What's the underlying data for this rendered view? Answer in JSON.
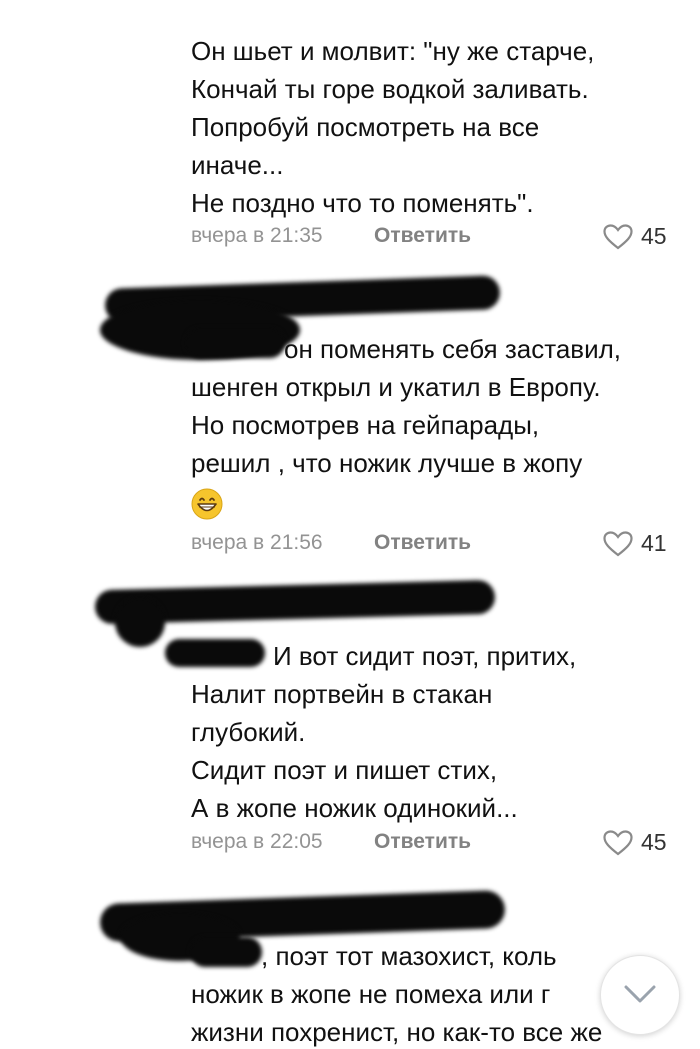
{
  "comments": [
    {
      "text": "Он шьет и молвит: \"ну же старче,\nКончай ты горе водкой заливать.\nПопробуй посмотреть на все\nиначе...\nНе поздно что то поменять\".",
      "time": "вчера в 21:35",
      "reply_label": "Ответить",
      "likes": "45"
    },
    {
      "text": "он поменять себя заставил,\nшенген открыл и укатил в Европу.\nНо посмотрев на гейпарады,\nрешил ,  что ножик лучше в жопу",
      "emoji": "grinning-face-icon",
      "time": "вчера в 21:56",
      "reply_label": "Ответить",
      "likes": "41"
    },
    {
      "text": "И вот сидит поэт, притих,\nНалит портвейн в стакан\nглубокий.\nСидит поэт и пишет стих,\nА в жопе ножик одинокий...",
      "time": "вчера в 22:05",
      "reply_label": "Ответить",
      "likes": "45"
    },
    {
      "text": ", поэт тот мазохист, коль\nножик в жопе не помеха или г\nжизни похренист, но как-то все же"
    }
  ],
  "icons": {
    "like": "heart-outline-icon",
    "scroll": "chevron-down-icon"
  },
  "colors": {
    "meta_text": "#939393",
    "reply_text": "#828282",
    "like_count": "#333333",
    "redaction": "#0a0a0a"
  }
}
